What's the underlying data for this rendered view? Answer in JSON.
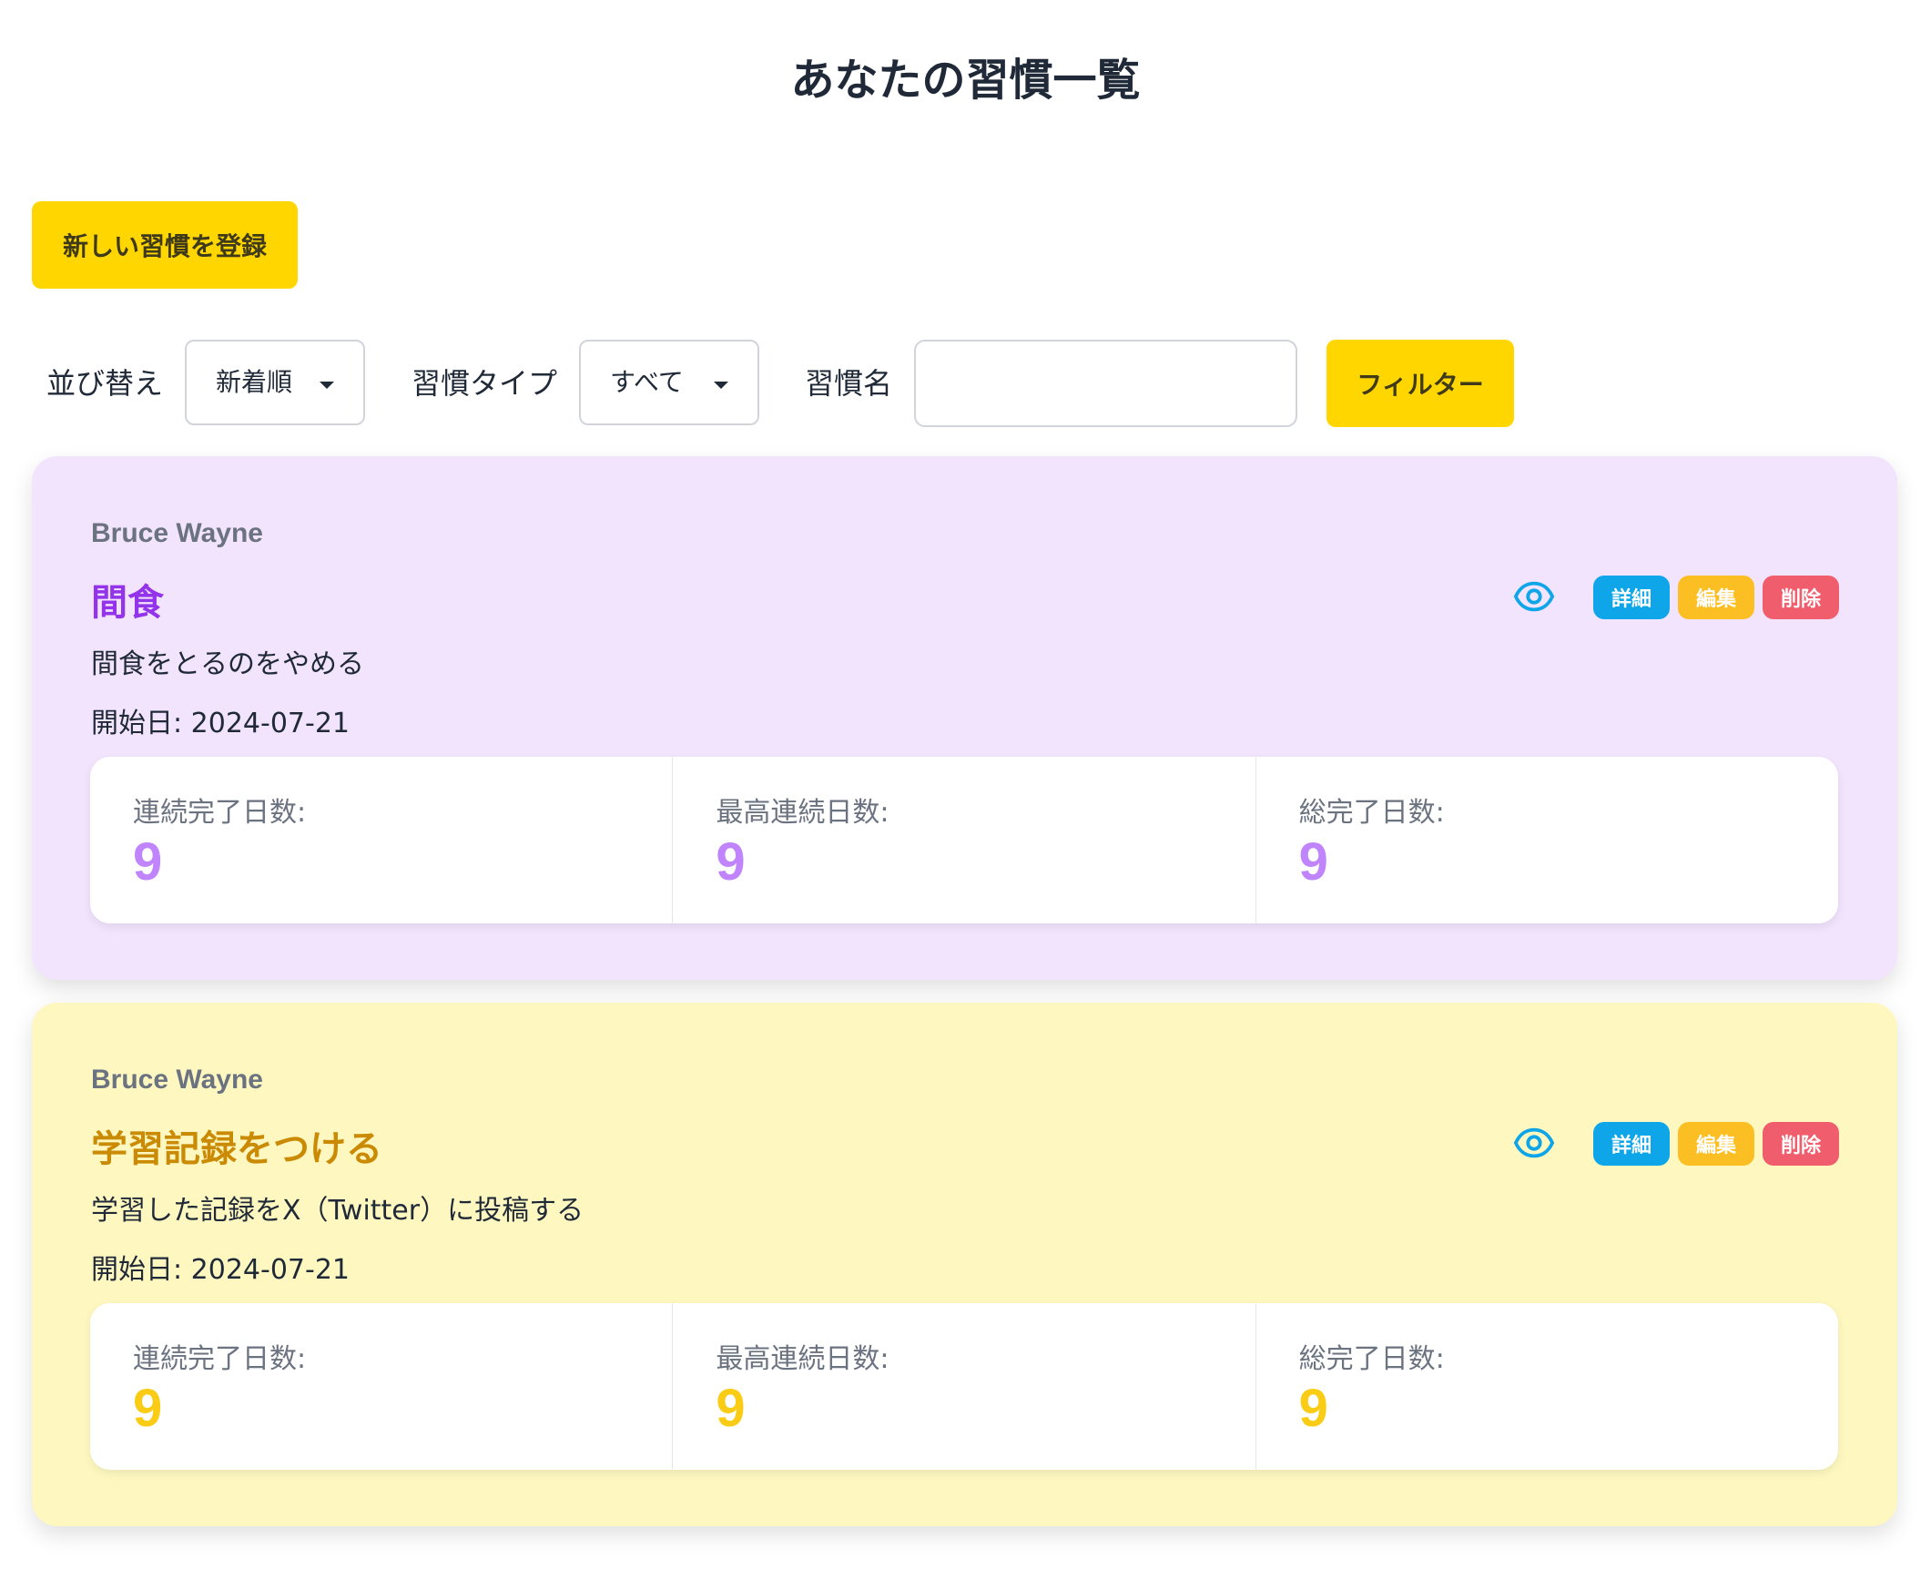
{
  "page": {
    "title": "あなたの習慣一覧"
  },
  "actions": {
    "new_habit_label": "新しい習慣を登録"
  },
  "filters": {
    "sort_label": "並び替え",
    "sort_value": "新着順",
    "type_label": "習慣タイプ",
    "type_value": "すべて",
    "name_label": "習慣名",
    "name_value": "",
    "name_placeholder": "",
    "filter_button_label": "フィルター"
  },
  "labels": {
    "start_prefix": "開始日:",
    "detail": "詳細",
    "edit": "編集",
    "delete": "削除",
    "streak": "連続完了日数:",
    "best_streak": "最高連続日数:",
    "total_days": "総完了日数:"
  },
  "habits": [
    {
      "user": "Bruce Wayne",
      "title": "間食",
      "description": "間食をとるのをやめる",
      "start_date": "2024-07-21",
      "streak": "9",
      "best_streak": "9",
      "total_days": "9",
      "card_color": "#f2e4fd",
      "title_color": "#9333ea",
      "value_color": "#c084fc"
    },
    {
      "user": "Bruce Wayne",
      "title": "学習記録をつける",
      "description": "学習した記録をX（Twitter）に投稿する",
      "start_date": "2024-07-21",
      "streak": "9",
      "best_streak": "9",
      "total_days": "9",
      "card_color": "#fef8c0",
      "title_color": "#ca8a04",
      "value_color": "#facc15"
    }
  ],
  "colors": {
    "primary_button": "#ffd600",
    "detail_button": "#0ea5e9",
    "edit_button": "#fbbf24",
    "delete_button": "#f05d6c",
    "eye_icon": "#0ea5e9"
  },
  "icons": {
    "view": "eye-icon",
    "dropdown": "caret-down-icon"
  }
}
